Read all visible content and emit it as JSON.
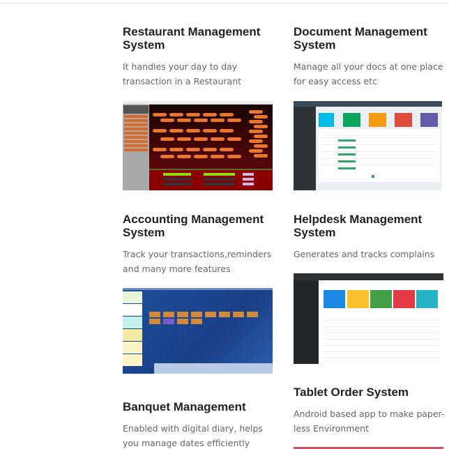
{
  "products": [
    {
      "title": "Restaurant Management System",
      "description": "It handles your day to day transaction in a Restaurant"
    },
    {
      "title": "Document Management System",
      "description": "Manage all your docs at one place for easy access etc"
    },
    {
      "title": "Accounting Management System",
      "description": "Track your transactions,reminders and many more features"
    },
    {
      "title": "Helpdesk Management System",
      "description": "Generates and tracks complains"
    },
    {
      "title": "Banquet Management",
      "description": "Enabled with digital diary, helps you manage dates efficiently"
    },
    {
      "title": "Tablet Order System",
      "description": "Android based app to make paper-less Environment"
    }
  ]
}
